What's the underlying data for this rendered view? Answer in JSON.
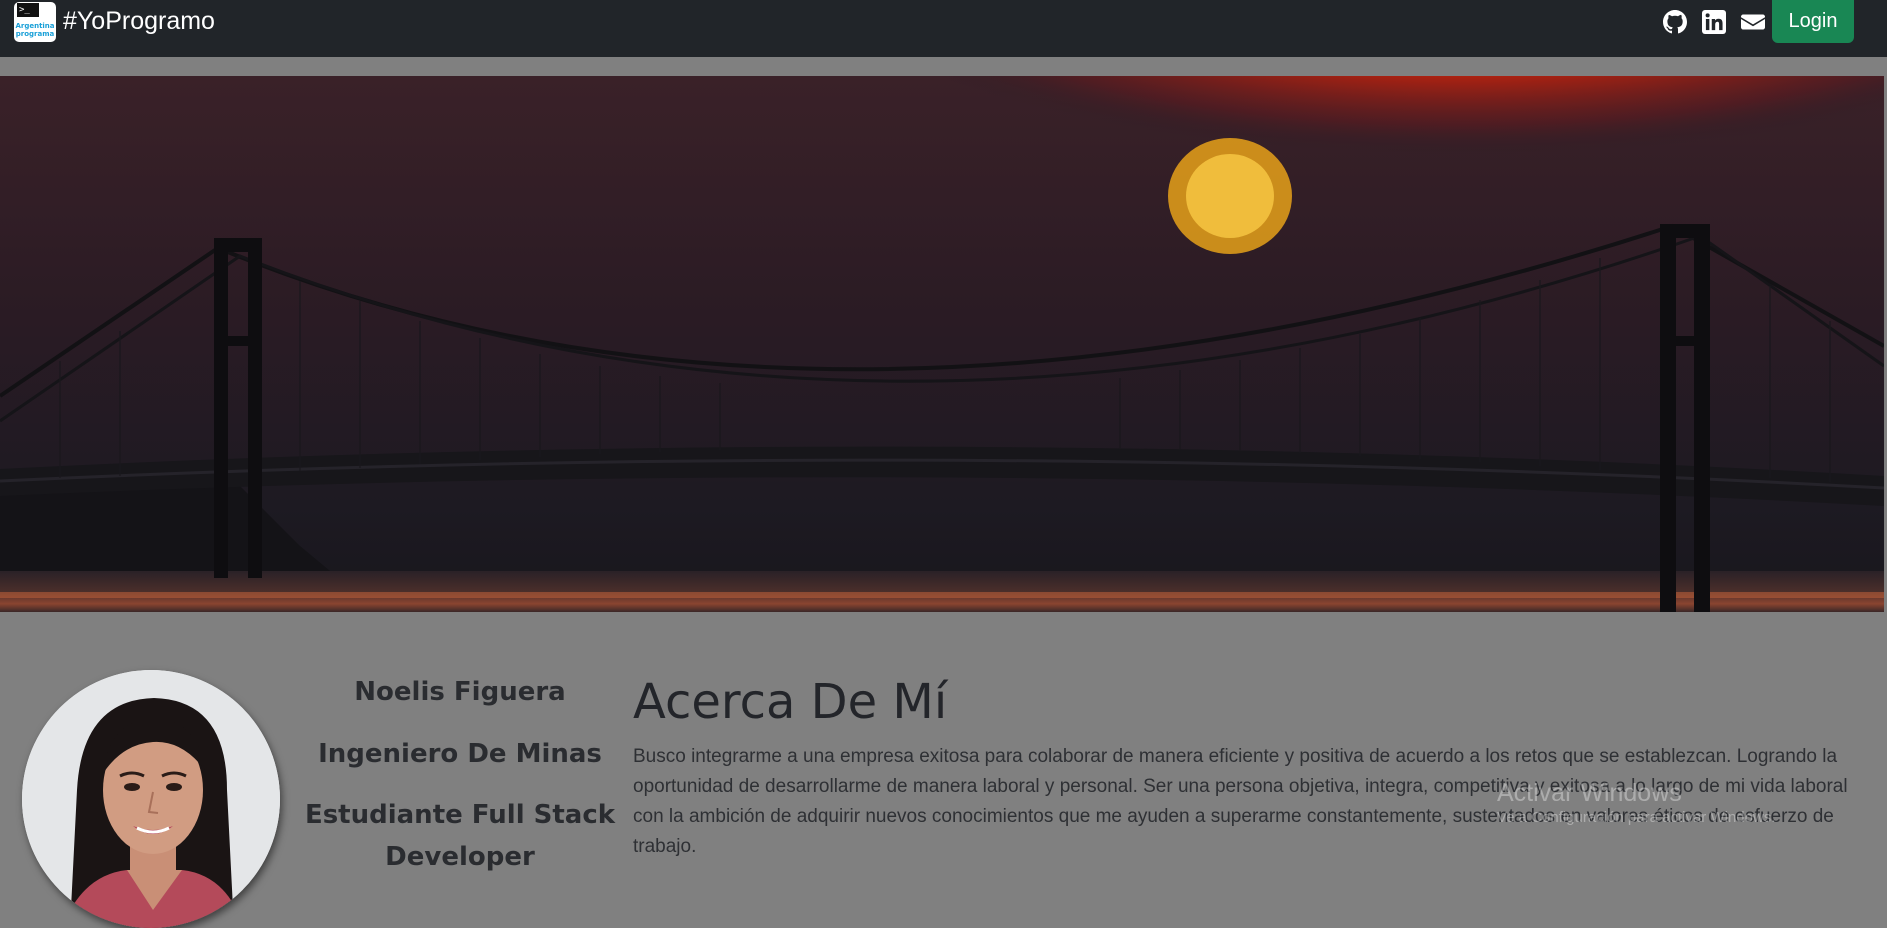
{
  "navbar": {
    "logo_lines": [
      "Argentina",
      "programa"
    ],
    "logo_prompt": ">_",
    "brand": "#YoProgramo",
    "icons": [
      "github-icon",
      "linkedin-icon",
      "envelope-icon"
    ],
    "login_label": "Login",
    "colors": {
      "background": "#212529",
      "login": "#198754"
    }
  },
  "banner": {
    "alt": "sunset over suspension bridge"
  },
  "profile": {
    "name": "Noelis Figuera",
    "title": "Ingeniero De Minas",
    "role_line1": "Estudiante Full Stack",
    "role_line2": "Developer"
  },
  "about": {
    "title": "Acerca De Mí",
    "text": "Busco integrarme a una empresa exitosa para colaborar de manera eficiente y positiva de acuerdo a los retos que se establezcan. Logrando la oportunidad de desarrollarme de manera laboral y personal. Ser una persona objetiva, integra, competitiva y exitosa a lo largo de mi vida laboral con la ambición de adquirir nuevos conocimientos que me ayuden a superarme constantemente, sustentados en valores éticos de esfuerzo de trabajo."
  },
  "watermark": {
    "line1": "Activar Windows",
    "line2": "Ve a Configuración para activar Windows."
  }
}
